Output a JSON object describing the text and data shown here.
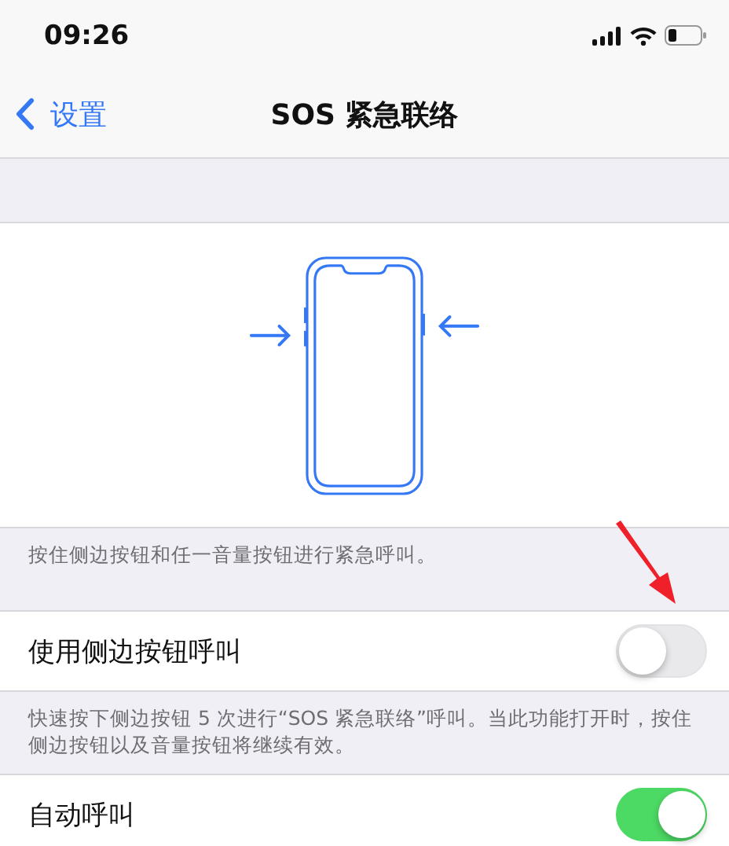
{
  "status_bar": {
    "time": "09:26"
  },
  "nav": {
    "back": "设置",
    "title": "SOS 紧急联络"
  },
  "illustration_caption": "按住侧边按钮和任一音量按钮进行紧急呼叫。",
  "settings": [
    {
      "kind": "toggle",
      "label": "使用侧边按钮呼叫",
      "on": false,
      "footer": "快速按下侧边按钮 5 次进行“SOS 紧急联络”呼叫。当此功能打开时，按住侧边按钮以及音量按钮将继续有效。"
    },
    {
      "kind": "toggle",
      "label": "自动呼叫",
      "on": true
    }
  ]
}
